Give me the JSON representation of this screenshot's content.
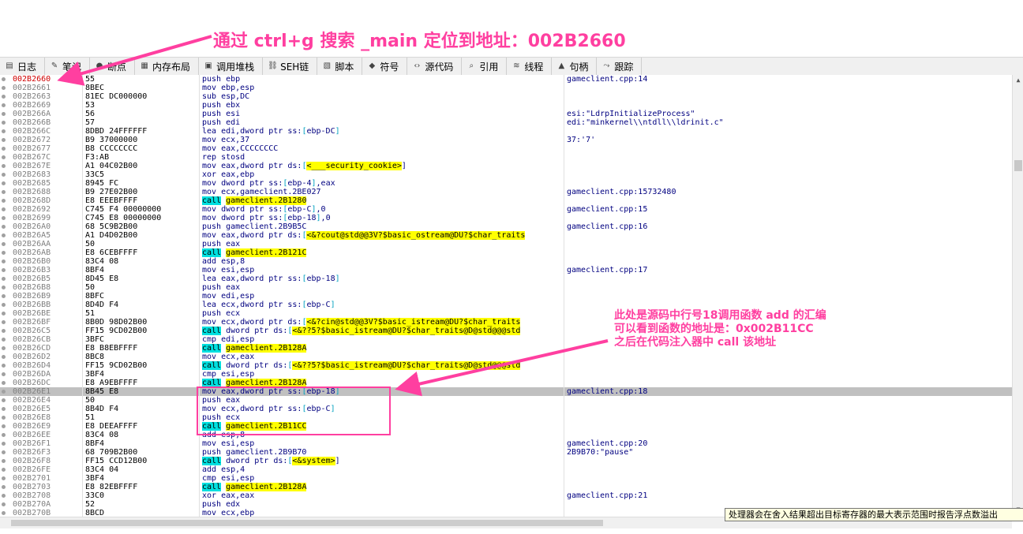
{
  "annotation_top": "通过 ctrl+g 搜索 _main 定位到地址：002B2660",
  "annotation_note": [
    "此处是源码中行号18调用函数 add 的汇编",
    "可以看到函数的地址是：0x002B11CC",
    "之后在代码注入器中 call 该地址"
  ],
  "tabs": [
    {
      "label": "日志",
      "icon": "log-icon",
      "glyph": "▤"
    },
    {
      "label": "笔记",
      "icon": "notes-icon",
      "glyph": "✎"
    },
    {
      "label": "断点",
      "icon": "breakpoint-icon",
      "glyph": "●"
    },
    {
      "label": "内存布局",
      "icon": "memory-map-icon",
      "glyph": "▦"
    },
    {
      "label": "调用堆栈",
      "icon": "call-stack-icon",
      "glyph": "▣"
    },
    {
      "label": "SEH链",
      "icon": "seh-chain-icon",
      "glyph": "⛓"
    },
    {
      "label": "脚本",
      "icon": "script-icon",
      "glyph": "▧"
    },
    {
      "label": "符号",
      "icon": "symbol-icon",
      "glyph": "◆"
    },
    {
      "label": "源代码",
      "icon": "source-code-icon",
      "glyph": "‹›"
    },
    {
      "label": "引用",
      "icon": "references-icon",
      "glyph": "⌕"
    },
    {
      "label": "线程",
      "icon": "threads-icon",
      "glyph": "≋"
    },
    {
      "label": "句柄",
      "icon": "handles-icon",
      "glyph": "▲"
    },
    {
      "label": "跟踪",
      "icon": "trace-icon",
      "glyph": "⤳"
    }
  ],
  "disasm": [
    {
      "addr": "002B2660",
      "bytes": "55",
      "instr": "push ebp",
      "comment": "gameclient.cpp:14",
      "eip": true
    },
    {
      "addr": "002B2661",
      "bytes": "8BEC",
      "instr": "mov ebp,esp",
      "comment": ""
    },
    {
      "addr": "002B2663",
      "bytes": "81EC DC000000",
      "instr": "sub esp,DC",
      "comment": ""
    },
    {
      "addr": "002B2669",
      "bytes": "53",
      "instr": "push ebx",
      "comment": ""
    },
    {
      "addr": "002B266A",
      "bytes": "56",
      "instr": "push esi",
      "comment": "esi:\"LdrpInitializeProcess\""
    },
    {
      "addr": "002B266B",
      "bytes": "57",
      "instr": "push edi",
      "comment": "edi:\"minkernel\\\\ntdll\\\\ldrinit.c\""
    },
    {
      "addr": "002B266C",
      "bytes": "8DBD 24FFFFFF",
      "instr": "lea edi,dword ptr ss:[ebp-DC]",
      "comment": ""
    },
    {
      "addr": "002B2672",
      "bytes": "B9 37000000",
      "instr": "mov ecx,37",
      "comment": "37:'7'"
    },
    {
      "addr": "002B2677",
      "bytes": "B8 CCCCCCCC",
      "instr": "mov eax,CCCCCCCC",
      "comment": ""
    },
    {
      "addr": "002B267C",
      "bytes": "F3:AB",
      "instr": "rep stosd",
      "comment": ""
    },
    {
      "addr": "002B267E",
      "bytes": "A1 04C02B00",
      "instr": "mov eax,dword ptr ds:[<___security_cookie>]",
      "comment": ""
    },
    {
      "addr": "002B2683",
      "bytes": "33C5",
      "instr": "xor eax,ebp",
      "comment": ""
    },
    {
      "addr": "002B2685",
      "bytes": "8945 FC",
      "instr": "mov dword ptr ss:[ebp-4],eax",
      "comment": ""
    },
    {
      "addr": "002B2688",
      "bytes": "B9 27E02B00",
      "instr": "mov ecx,gameclient.2BE027",
      "comment": "gameclient.cpp:15732480"
    },
    {
      "addr": "002B268D",
      "bytes": "E8 EEEBFFFF",
      "instr": "call gameclient.2B1280",
      "comment": ""
    },
    {
      "addr": "002B2692",
      "bytes": "C745 F4 00000000",
      "instr": "mov dword ptr ss:[ebp-C],0",
      "comment": "gameclient.cpp:15"
    },
    {
      "addr": "002B2699",
      "bytes": "C745 E8 00000000",
      "instr": "mov dword ptr ss:[ebp-18],0",
      "comment": ""
    },
    {
      "addr": "002B26A0",
      "bytes": "68 5C9B2B00",
      "instr": "push gameclient.2B9B5C",
      "comment": "gameclient.cpp:16"
    },
    {
      "addr": "002B26A5",
      "bytes": "A1 D4D02B00",
      "instr": "mov eax,dword ptr ds:[<&?cout@std@@3V?$basic_ostream@DU?$char_traits",
      "comment": ""
    },
    {
      "addr": "002B26AA",
      "bytes": "50",
      "instr": "push eax",
      "comment": ""
    },
    {
      "addr": "002B26AB",
      "bytes": "E8 6CEBFFFF",
      "instr": "call gameclient.2B121C",
      "comment": ""
    },
    {
      "addr": "002B26B0",
      "bytes": "83C4 08",
      "instr": "add esp,8",
      "comment": ""
    },
    {
      "addr": "002B26B3",
      "bytes": "8BF4",
      "instr": "mov esi,esp",
      "comment": "gameclient.cpp:17"
    },
    {
      "addr": "002B26B5",
      "bytes": "8D45 E8",
      "instr": "lea eax,dword ptr ss:[ebp-18]",
      "comment": ""
    },
    {
      "addr": "002B26B8",
      "bytes": "50",
      "instr": "push eax",
      "comment": ""
    },
    {
      "addr": "002B26B9",
      "bytes": "8BFC",
      "instr": "mov edi,esp",
      "comment": ""
    },
    {
      "addr": "002B26BB",
      "bytes": "8D4D F4",
      "instr": "lea ecx,dword ptr ss:[ebp-C]",
      "comment": ""
    },
    {
      "addr": "002B26BE",
      "bytes": "51",
      "instr": "push ecx",
      "comment": ""
    },
    {
      "addr": "002B26BF",
      "bytes": "8B0D 98D02B00",
      "instr": "mov ecx,dword ptr ds:[<&?cin@std@@3V?$basic_istream@DU?$char_traits",
      "comment": ""
    },
    {
      "addr": "002B26C5",
      "bytes": "FF15 9CD02B00",
      "instr": "call dword ptr ds:[<&??5?$basic_istream@DU?$char_traits@D@std@@@std",
      "comment": ""
    },
    {
      "addr": "002B26CB",
      "bytes": "3BFC",
      "instr": "cmp edi,esp",
      "comment": ""
    },
    {
      "addr": "002B26CD",
      "bytes": "E8 B8EBFFFF",
      "instr": "call gameclient.2B128A",
      "comment": ""
    },
    {
      "addr": "002B26D2",
      "bytes": "8BC8",
      "instr": "mov ecx,eax",
      "comment": ""
    },
    {
      "addr": "002B26D4",
      "bytes": "FF15 9CD02B00",
      "instr": "call dword ptr ds:[<&??5?$basic_istream@DU?$char_traits@D@std@@@std",
      "comment": ""
    },
    {
      "addr": "002B26DA",
      "bytes": "3BF4",
      "instr": "cmp esi,esp",
      "comment": ""
    },
    {
      "addr": "002B26DC",
      "bytes": "E8 A9EBFFFF",
      "instr": "call gameclient.2B128A",
      "comment": ""
    },
    {
      "addr": "002B26E1",
      "bytes": "8B45 E8",
      "instr": "mov eax,dword ptr ss:[ebp-18]",
      "comment": "gameclient.cpp:18",
      "current": true
    },
    {
      "addr": "002B26E4",
      "bytes": "50",
      "instr": "push eax",
      "comment": ""
    },
    {
      "addr": "002B26E5",
      "bytes": "8B4D F4",
      "instr": "mov ecx,dword ptr ss:[ebp-C]",
      "comment": ""
    },
    {
      "addr": "002B26E8",
      "bytes": "51",
      "instr": "push ecx",
      "comment": ""
    },
    {
      "addr": "002B26E9",
      "bytes": "E8 DEEAFFFF",
      "instr": "call gameclient.2B11CC",
      "comment": ""
    },
    {
      "addr": "002B26EE",
      "bytes": "83C4 08",
      "instr": "add esp,8",
      "comment": ""
    },
    {
      "addr": "002B26F1",
      "bytes": "8BF4",
      "instr": "mov esi,esp",
      "comment": "gameclient.cpp:20"
    },
    {
      "addr": "002B26F3",
      "bytes": "68 709B2B00",
      "instr": "push gameclient.2B9B70",
      "comment": "2B9B70:\"pause\""
    },
    {
      "addr": "002B26F8",
      "bytes": "FF15 CCD12B00",
      "instr": "call dword ptr ds:[<&system>]",
      "comment": ""
    },
    {
      "addr": "002B26FE",
      "bytes": "83C4 04",
      "instr": "add esp,4",
      "comment": ""
    },
    {
      "addr": "002B2701",
      "bytes": "3BF4",
      "instr": "cmp esi,esp",
      "comment": ""
    },
    {
      "addr": "002B2703",
      "bytes": "E8 82EBFFFF",
      "instr": "call gameclient.2B128A",
      "comment": ""
    },
    {
      "addr": "002B2708",
      "bytes": "33C0",
      "instr": "xor eax,eax",
      "comment": "gameclient.cpp:21"
    },
    {
      "addr": "002B270A",
      "bytes": "52",
      "instr": "push edx",
      "comment": ""
    },
    {
      "addr": "002B270B",
      "bytes": "8BCD",
      "instr": "mov ecx,ebp",
      "comment": ""
    }
  ],
  "tooltip": "处理器会在舍入结果超出目标寄存器的最大表示范围时报告浮点数溢出",
  "colors": {
    "annotation": "#ff3fa0",
    "call_highlight": "#00e0e0",
    "symbol_highlight": "#ffff00",
    "eip_address": "#d00000"
  }
}
